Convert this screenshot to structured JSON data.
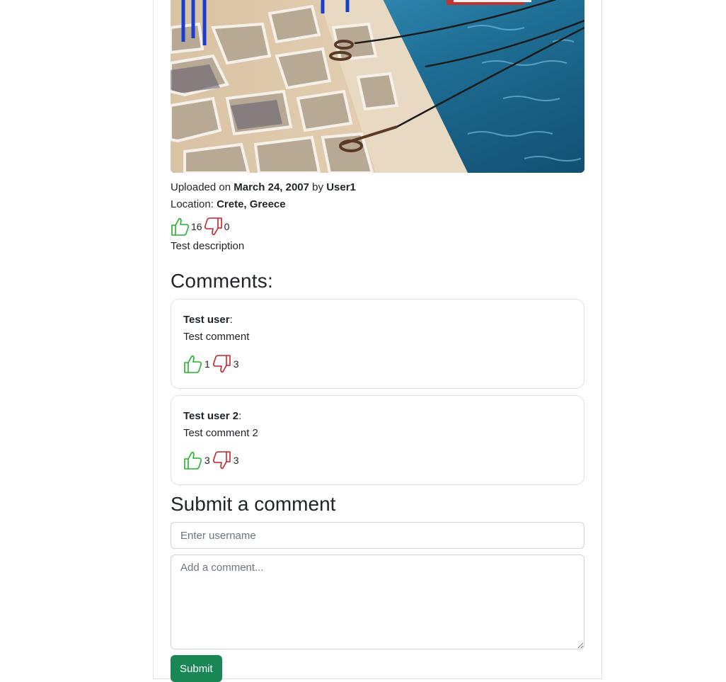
{
  "photo": {
    "alt_icon": "harbor-photo"
  },
  "meta": {
    "uploaded_prefix": "Uploaded on",
    "uploaded_date": "March 24, 2007",
    "by_word": "by",
    "uploader": "User1",
    "location_prefix": "Location:",
    "location": "Crete, Greece"
  },
  "votes": {
    "likes": "16",
    "dislikes": "0"
  },
  "description": "Test description",
  "comments_title": "Comments:",
  "comments": [
    {
      "author": "Test user",
      "text": "Test comment",
      "likes": "1",
      "dislikes": "3"
    },
    {
      "author": "Test user 2",
      "text": "Test comment 2",
      "likes": "3",
      "dislikes": "3"
    }
  ],
  "colon": ":",
  "submit": {
    "title": "Submit a comment",
    "username_placeholder": "Enter username",
    "comment_placeholder": "Add a comment...",
    "button_label": "Submit"
  },
  "colors": {
    "like": "#22b22a",
    "dislike": "#c8202a",
    "submit_button": "#198754"
  }
}
